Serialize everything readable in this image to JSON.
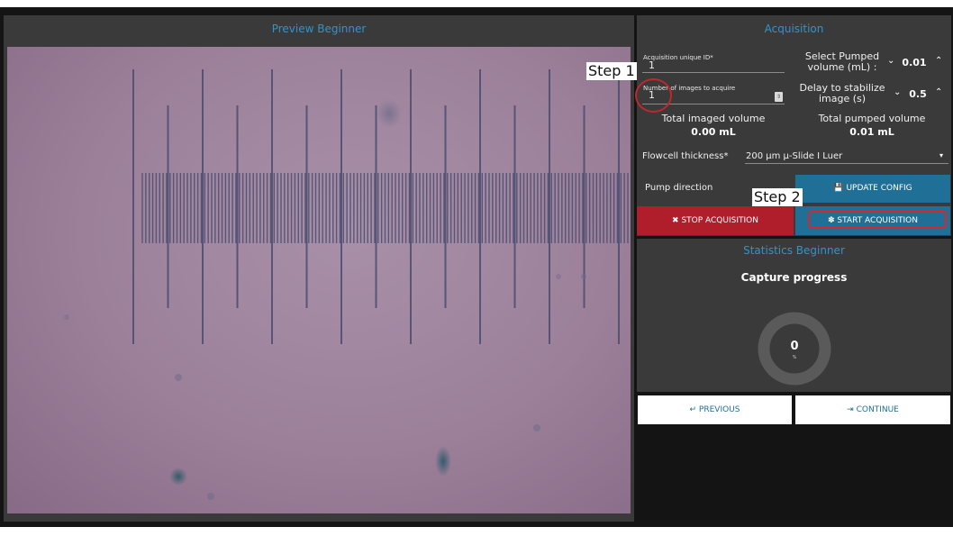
{
  "preview": {
    "title": "Preview Beginner"
  },
  "acquisition": {
    "title": "Acquisition",
    "id_label": "Acquisition unique ID*",
    "id_value": "1",
    "images_label": "Number of images to acquire",
    "images_value": "1",
    "pumped_label": "Select Pumped volume (mL) :",
    "pumped_value": "0.01",
    "delay_label": "Delay to stabilize image (s)",
    "delay_value": "0.5",
    "total_imaged_label": "Total imaged volume",
    "total_imaged_value": "0.00 mL",
    "total_pumped_label": "Total pumped volume",
    "total_pumped_value": "0.01 mL",
    "flowcell_label": "Flowcell thickness*",
    "flowcell_value": "200 μm μ-Slide I Luer",
    "pump_direction_label": "Pump direction",
    "update_config": "UPDATE CONFIG",
    "stop_acquisition": "STOP ACQUISITION",
    "start_acquisition": "START ACQUISITION"
  },
  "statistics": {
    "title": "Statistics Beginner",
    "capture_progress": "Capture progress",
    "progress_value": "0",
    "progress_unit": "%",
    "progress_fraction": 0
  },
  "nav": {
    "previous": "PREVIOUS",
    "continue": "CONTINUE"
  },
  "annotations": {
    "step1": "Step 1",
    "step2": "Step 2",
    "highlight_color": "#c1272d"
  },
  "colors": {
    "accent": "#2e95cf",
    "primary_button": "#1f6f96",
    "danger_button": "#b01d2b",
    "panel": "#3a3a3a"
  }
}
